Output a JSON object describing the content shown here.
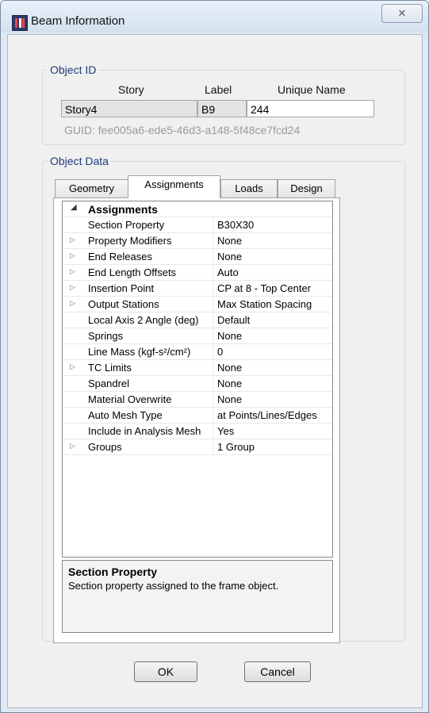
{
  "window": {
    "title": "Beam Information",
    "close_glyph": "✕"
  },
  "object_id": {
    "legend": "Object ID",
    "headers": {
      "story": "Story",
      "label": "Label",
      "unique_name": "Unique Name"
    },
    "values": {
      "story": "Story4",
      "label": "B9",
      "unique_name": "244"
    },
    "guid": "GUID:  fee005a6-ede5-46d3-a148-5f48ce7fcd24"
  },
  "object_data": {
    "legend": "Object Data",
    "tabs": [
      "Geometry",
      "Assignments",
      "Loads",
      "Design"
    ],
    "active_tab": "Assignments",
    "category": "Assignments",
    "rows": [
      {
        "name": "Section Property",
        "value": "B30X30",
        "expandable": false
      },
      {
        "name": "Property Modifiers",
        "value": "None",
        "expandable": true
      },
      {
        "name": "End Releases",
        "value": "None",
        "expandable": true
      },
      {
        "name": "End Length Offsets",
        "value": "Auto",
        "expandable": true
      },
      {
        "name": "Insertion Point",
        "value": "CP at 8 - Top Center",
        "expandable": true
      },
      {
        "name": "Output Stations",
        "value": "Max Station Spacing",
        "expandable": true
      },
      {
        "name": "Local Axis 2 Angle (deg)",
        "value": "Default",
        "expandable": false
      },
      {
        "name": "Springs",
        "value": "None",
        "expandable": false
      },
      {
        "name": "Line Mass (kgf-s²/cm²)",
        "value": "0",
        "expandable": false
      },
      {
        "name": "TC Limits",
        "value": "None",
        "expandable": true
      },
      {
        "name": "Spandrel",
        "value": "None",
        "expandable": false
      },
      {
        "name": "Material Overwrite",
        "value": "None",
        "expandable": false
      },
      {
        "name": "Auto Mesh Type",
        "value": "at Points/Lines/Edges",
        "expandable": false
      },
      {
        "name": "Include in Analysis Mesh",
        "value": "Yes",
        "expandable": false
      },
      {
        "name": "Groups",
        "value": "1 Group",
        "expandable": true
      }
    ],
    "description": {
      "title": "Section Property",
      "text": "Section property assigned to the frame object."
    }
  },
  "buttons": {
    "ok": "OK",
    "cancel": "Cancel"
  }
}
